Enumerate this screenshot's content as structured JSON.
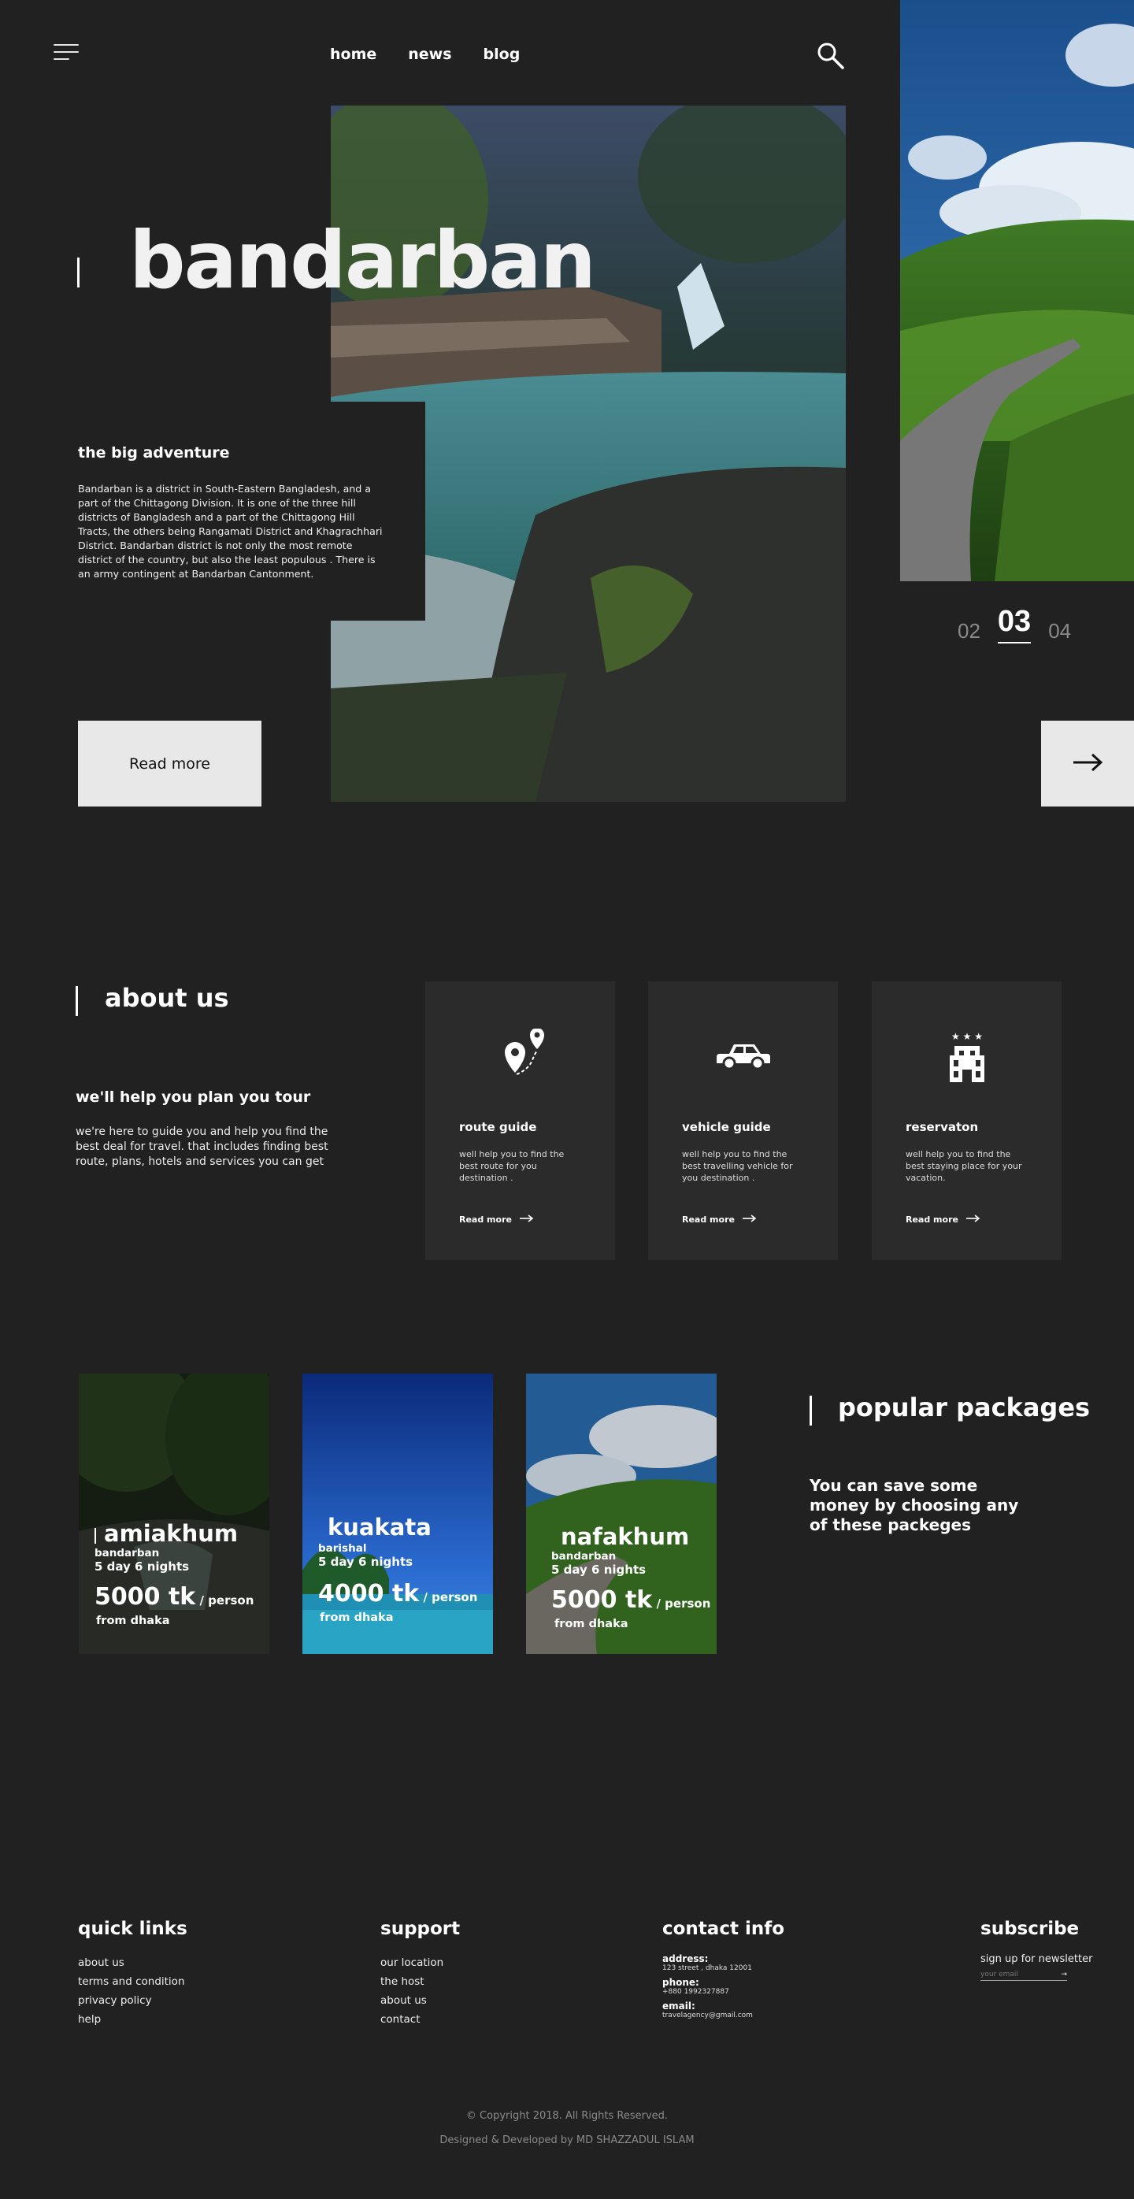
{
  "nav": {
    "items": [
      "home",
      "news",
      "blog"
    ],
    "menu_icon": "hamburger-icon",
    "search_icon": "search-icon"
  },
  "hero": {
    "title": "bandarban",
    "subtitle": "the big adventure",
    "description": "Bandarban  is a district in South-Eastern Bangladesh, and a part of the Chittagong Division. It is one of the three hill districts of Bangladesh and a part of the Chittagong Hill Tracts, the others being Rangamati District and Khagrachhari District. Bandarban district is not only the most remote district of the country, but also the least populous . There is an army contingent at Bandarban Cantonment.",
    "read_more": "Read more",
    "pager": [
      "02",
      "03",
      "04"
    ],
    "active_page": "03",
    "next_icon": "arrow-right-icon"
  },
  "about": {
    "title": "about us",
    "subtitle": "we'll help you plan you tour",
    "description": "we're here to guide you and help you find the best deal for travel. that includes finding best route, plans, hotels and services you can get",
    "cards": [
      {
        "icon": "route-pin-icon",
        "title": "route guide",
        "text": "well help you to find the best route for you destination .",
        "link": "Read more"
      },
      {
        "icon": "car-icon",
        "title": "vehicle guide",
        "text": "well help you to find the best travelling vehicle for you destination .",
        "link": "Read more"
      },
      {
        "icon": "hotel-icon",
        "title": "reservaton",
        "text": "well help you to find the best staying place for your vacation.",
        "link": "Read more"
      }
    ]
  },
  "packages": {
    "title": "popular packages",
    "description": "You can save some money by choosing any of these packeges",
    "items": [
      {
        "name": "amiakhum",
        "location": "bandarban",
        "duration": "5 day 6 nights",
        "price": "5000 tk",
        "unit": " / person",
        "from": "from dhaka"
      },
      {
        "name": "kuakata",
        "location": "barishal",
        "duration": "5 day 6 nights",
        "price": "4000 tk",
        "unit": " / person",
        "from": "from dhaka"
      },
      {
        "name": "nafakhum",
        "location": "bandarban",
        "duration": "5 day 6 nights",
        "price": "5000 tk",
        "unit": " / person",
        "from": "from dhaka"
      }
    ]
  },
  "footer": {
    "quick_links": {
      "title": "quick links",
      "items": [
        "about us",
        "terms and condition",
        "privacy policy",
        "help"
      ]
    },
    "support": {
      "title": "support",
      "items": [
        "our location",
        "the host",
        "about us",
        "contact"
      ]
    },
    "contact": {
      "title": "contact info",
      "address_label": "address:",
      "address": "123 street , dhaka 12001",
      "phone_label": "phone:",
      "phone": "+880 1992327887",
      "email_label": "email:",
      "email": "travelagency@gmail.com"
    },
    "subscribe": {
      "title": "subscribe",
      "text": "sign up for newsletter",
      "placeholder": "your email"
    },
    "copyright": "© Copyright 2018. All Rights Reserved.",
    "credit": "Designed & Developed by MD SHAZZADUL ISLAM"
  },
  "colors": {
    "background": "#212121",
    "card": "#2b2b2b",
    "button": "#e8e8e8"
  }
}
